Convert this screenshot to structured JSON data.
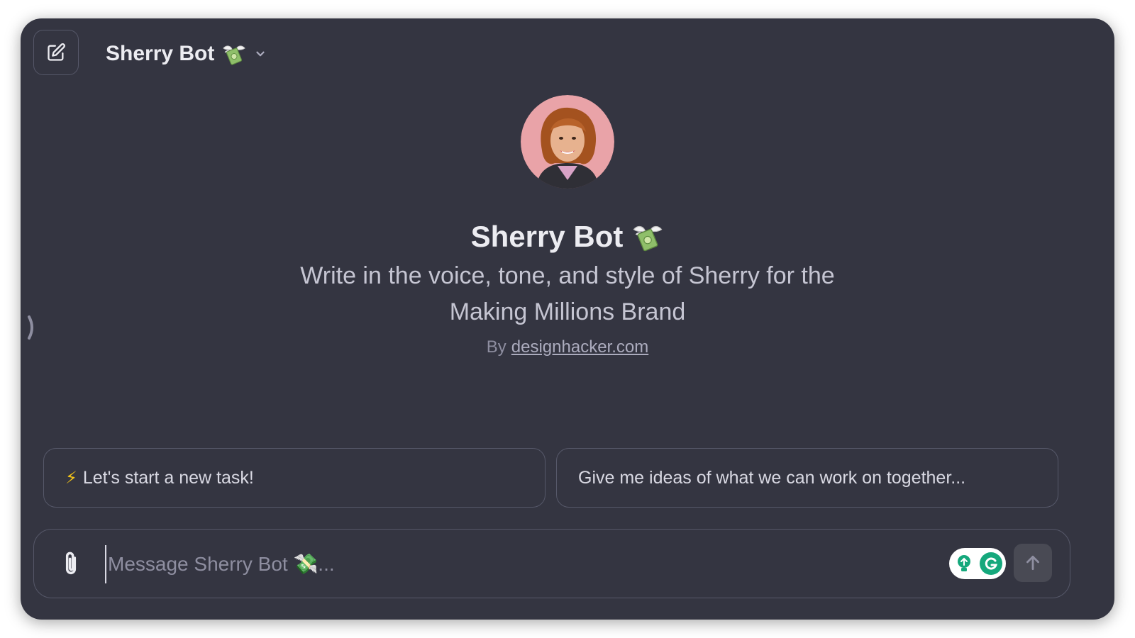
{
  "header": {
    "model_name": "Sherry Bot",
    "new_chat_icon": "edit-icon",
    "dropdown_icon": "chevron-down-icon",
    "badge_icon": "money-with-wings-emoji"
  },
  "gpt": {
    "name": "Sherry Bot",
    "description": "Write in the voice, tone, and style of Sherry for the Making Millions Brand",
    "by_label": "By",
    "author": "designhacker.com"
  },
  "suggestions": [
    {
      "icon": "lightning-emoji",
      "label": "Let's start a new task!"
    },
    {
      "label": "Give me ideas of what we can work on together..."
    }
  ],
  "composer": {
    "placeholder": "Message Sherry Bot 💸...",
    "attach_icon": "paperclip-icon",
    "send_icon": "arrow-up-icon",
    "extension_icons": [
      "lightbulb-extension-icon",
      "grammarly-icon"
    ]
  },
  "colors": {
    "background": "#343541",
    "border": "#565869",
    "text": "#ececf1",
    "muted": "#8e8ea0",
    "accent_green": "#15a87c",
    "bolt": "#f5c518"
  }
}
